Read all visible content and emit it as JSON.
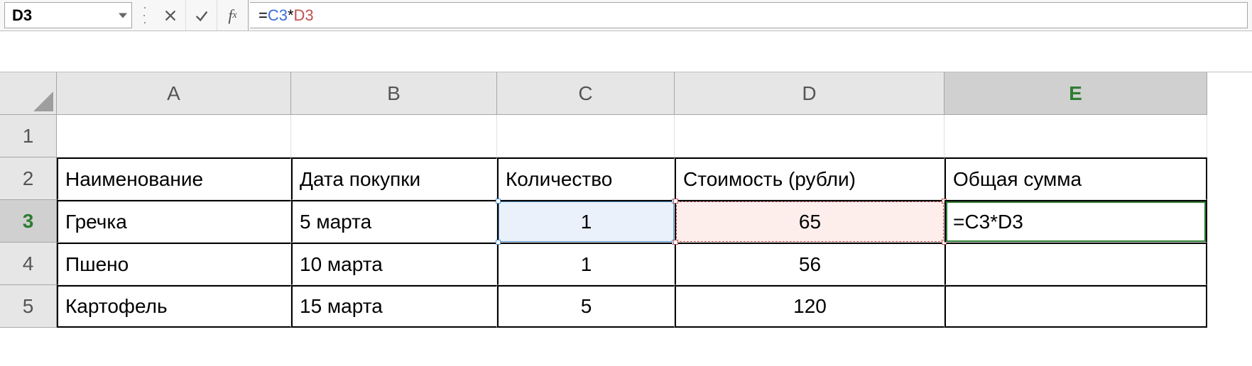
{
  "nameBox": "D3",
  "formula": {
    "c": "C3",
    "d": "D3"
  },
  "columns": [
    "A",
    "B",
    "C",
    "D",
    "E"
  ],
  "rows": [
    "1",
    "2",
    "3",
    "4",
    "5"
  ],
  "activeColumn": "E",
  "activeRow": "3",
  "cells": {
    "r2": {
      "A": "Наименование",
      "B": "Дата покупки",
      "C": "Количество",
      "D": "Стоимость (рубли)",
      "E": "Общая сумма"
    },
    "r3": {
      "A": "Гречка",
      "B": "5 марта",
      "C": "1",
      "D": "65",
      "E": "=C3*D3"
    },
    "r4": {
      "A": "Пшено",
      "B": "10 марта",
      "C": "1",
      "D": "56",
      "E": ""
    },
    "r5": {
      "A": "Картофель",
      "B": "15 марта",
      "C": "5",
      "D": "120",
      "E": ""
    }
  }
}
